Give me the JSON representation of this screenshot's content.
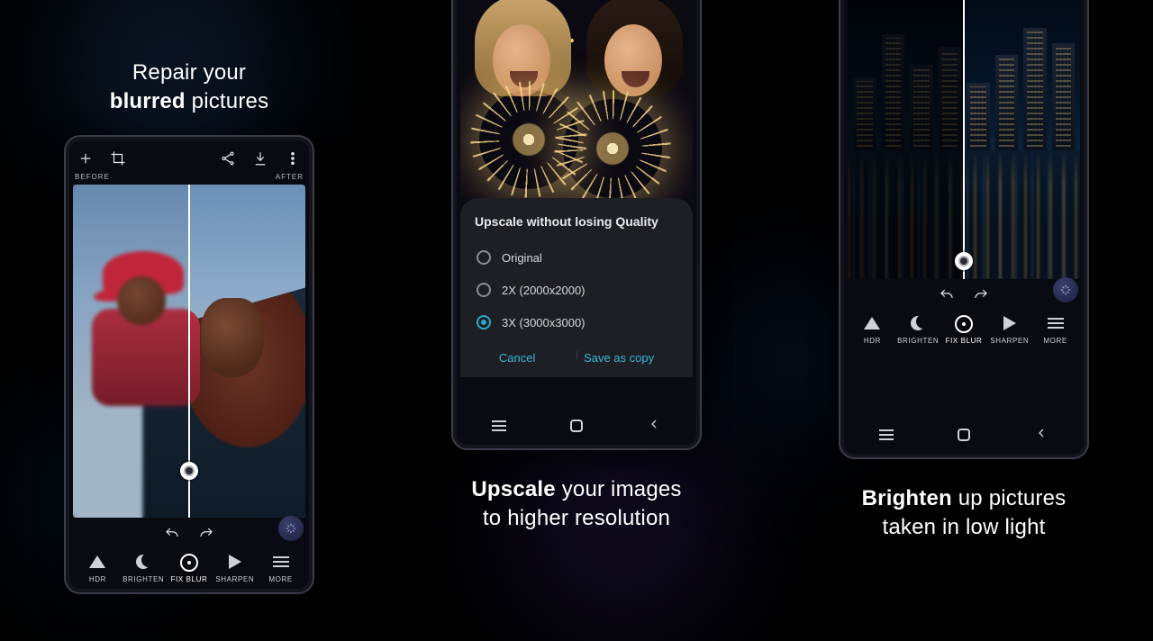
{
  "taglines": {
    "left_pre": "Repair your",
    "left_bold": "blurred",
    "left_post": " pictures",
    "mid_bold": "Upscale",
    "mid_line1_post": " your images",
    "mid_line2": "to higher resolution",
    "right_bold": "Brighten",
    "right_line1_post": " up pictures",
    "right_line2": "taken in low light"
  },
  "editor": {
    "before": "BEFORE",
    "after": "AFTER",
    "tools": {
      "hdr": "HDR",
      "brighten": "BRIGHTEN",
      "fixblur": "FIX BLUR",
      "sharpen": "SHARPEN",
      "more": "MORE"
    }
  },
  "upscale_sheet": {
    "title": "Upscale without losing Quality",
    "options": {
      "original": "Original",
      "x2": "2X (2000x2000)",
      "x3": "3X (3000x3000)"
    },
    "selected": "x3",
    "cancel": "Cancel",
    "save": "Save as copy"
  }
}
